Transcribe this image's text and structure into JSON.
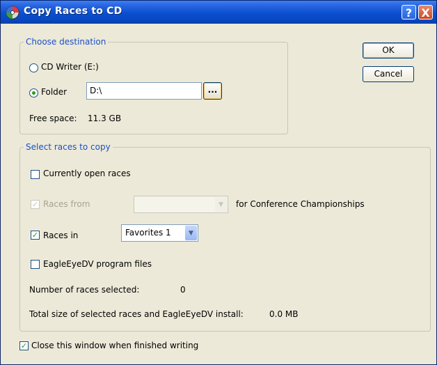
{
  "window": {
    "title": "Copy Races to CD",
    "help_label": "?",
    "close_label": "X"
  },
  "buttons": {
    "ok": "OK",
    "cancel": "Cancel"
  },
  "destination": {
    "legend": "Choose destination",
    "cd_writer_label": "CD Writer (E:)",
    "folder_label": "Folder",
    "folder_value": "D:\\",
    "browse_label": "...",
    "free_space_label": "Free space:",
    "free_space_value": "11.3 GB"
  },
  "races": {
    "legend": "Select races to copy",
    "currently_open_label": "Currently open races",
    "races_from_label": "Races from",
    "races_from_value": "",
    "for_text": "for Conference Championships",
    "races_in_label": "Races in",
    "races_in_value": "Favorites 1",
    "program_files_label": "EagleEyeDV program files",
    "num_selected_label": "Number of races selected:",
    "num_selected_value": "0",
    "total_size_label": "Total size of selected races and EagleEyeDV install:",
    "total_size_value": "0.0 MB"
  },
  "close_when_finished_label": "Close this window when finished writing",
  "state": {
    "cd_writer_selected": false,
    "folder_selected": true,
    "currently_open_checked": false,
    "races_from_checked": true,
    "races_from_enabled": false,
    "races_in_checked": true,
    "program_files_checked": false,
    "close_when_finished_checked": true
  },
  "colors": {
    "title_bar": "#0a4fd0",
    "dialog_bg": "#ece9d8",
    "group_label": "#1c4fc8",
    "check_mark": "#21a121"
  }
}
